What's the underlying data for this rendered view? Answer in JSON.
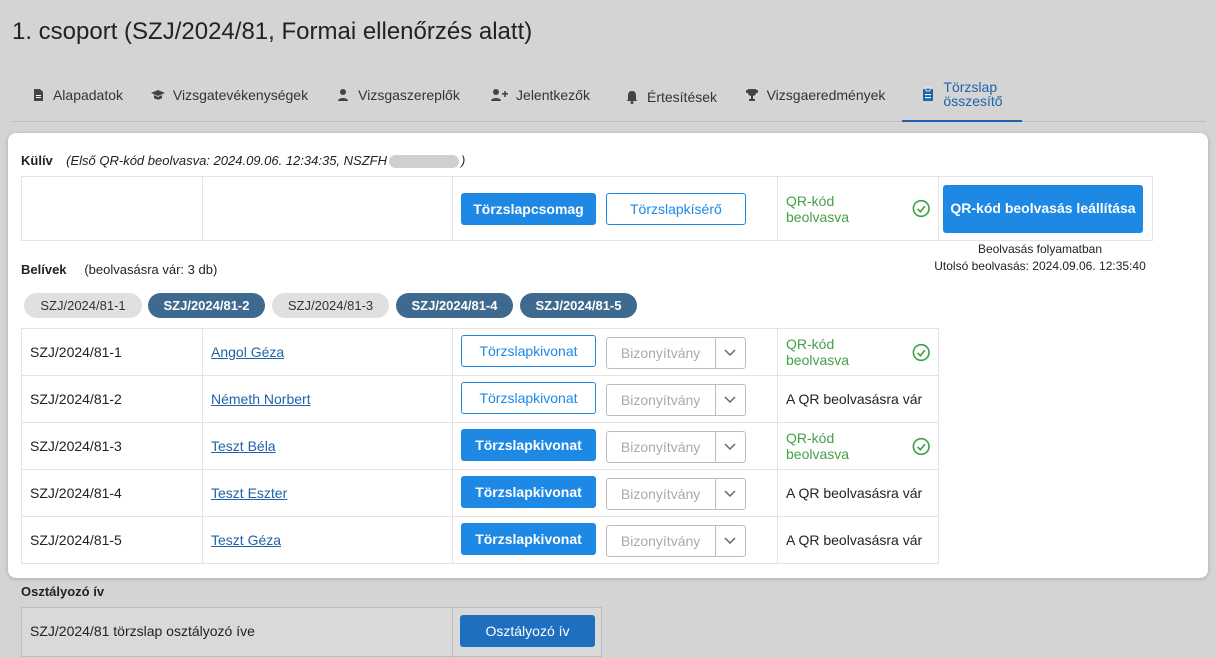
{
  "page_title": "1. csoport (SZJ/2024/81, Formai ellenőrzés alatt)",
  "tabs": [
    {
      "label": "Alapadatok",
      "icon": "document-icon"
    },
    {
      "label": "Vizsgatevékenységek",
      "icon": "graduation-cap-icon"
    },
    {
      "label": "Vizsgaszereplők",
      "icon": "person-icon"
    },
    {
      "label": "Jelentkezők",
      "icon": "person-add-icon"
    },
    {
      "label": "Értesítések",
      "icon": "bell-icon"
    },
    {
      "label": "Vizsgaeredmények",
      "icon": "trophy-icon"
    },
    {
      "label_line1": "Törzslap",
      "label_line2": "összesítő",
      "icon": "clipboard-icon",
      "active": true
    }
  ],
  "kuliv": {
    "title": "Külív",
    "subtitle_prefix": "(Első QR-kód beolvasva: 2024.09.06. 12:34:35, NSZFH",
    "subtitle_suffix": ")",
    "btn_package": "Törzslapcsomag",
    "btn_cover": "Törzslapkísérő",
    "status": "QR-kód beolvasva",
    "btn_stop": "QR-kód beolvasás leállítása",
    "scan_status": "Beolvasás folyamatban",
    "last_scan": "Utolsó beolvasás: 2024.09.06. 12:35:40"
  },
  "belivek": {
    "title": "Belívek",
    "subtitle": "(beolvasásra vár: 3 db)",
    "chips": [
      "SZJ/2024/81-1",
      "SZJ/2024/81-2",
      "SZJ/2024/81-3",
      "SZJ/2024/81-4",
      "SZJ/2024/81-5"
    ],
    "rows": [
      {
        "id": "SZJ/2024/81-1",
        "name": "Angol Géza",
        "btn": "Törzslapkivonat",
        "select": "Bizonyítvány",
        "status": "QR-kód beolvasva"
      },
      {
        "id": "SZJ/2024/81-2",
        "name": "Németh Norbert",
        "btn": "Törzslapkivonat",
        "select": "Bizonyítvány",
        "status": "A QR beolvasásra vár"
      },
      {
        "id": "SZJ/2024/81-3",
        "name": "Teszt Béla",
        "btn": "Törzslapkivonat",
        "select": "Bizonyítvány",
        "status": "QR-kód beolvasva"
      },
      {
        "id": "SZJ/2024/81-4",
        "name": "Teszt Eszter",
        "btn": "Törzslapkivonat",
        "select": "Bizonyítvány",
        "status": "A QR beolvasásra vár"
      },
      {
        "id": "SZJ/2024/81-5",
        "name": "Teszt Géza",
        "btn": "Törzslapkivonat",
        "select": "Bizonyítvány",
        "status": "A QR beolvasásra vár"
      }
    ]
  },
  "osztalyozo": {
    "title": "Osztályozó ív",
    "row_label": "SZJ/2024/81 törzslap osztályozó íve",
    "btn": "Osztályozó ív"
  },
  "colors": {
    "primary": "#1e88e5",
    "active_tab": "#1f63a8",
    "success": "#43a047",
    "chip_dark": "#3e6a8f"
  }
}
